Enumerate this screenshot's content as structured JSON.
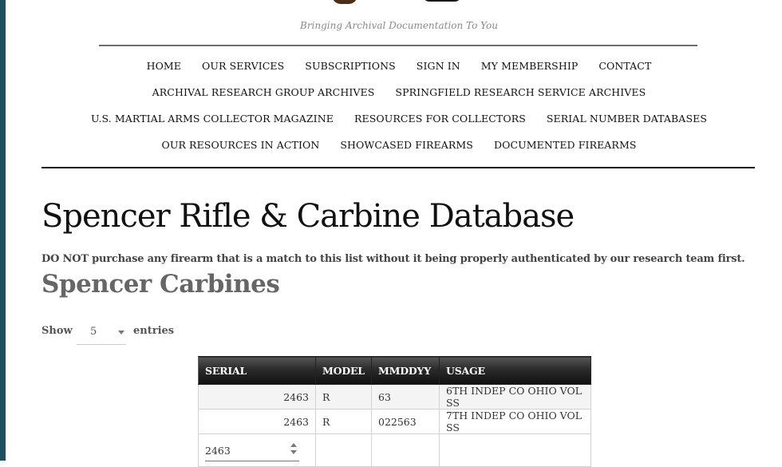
{
  "site": {
    "tagline": "Bringing Archival Documentation To You"
  },
  "nav": {
    "rows": [
      [
        "HOME",
        "OUR SERVICES",
        "SUBSCRIPTIONS",
        "SIGN IN",
        "MY MEMBERSHIP",
        "CONTACT"
      ],
      [
        "ARCHIVAL RESEARCH GROUP ARCHIVES",
        "SPRINGFIELD RESEARCH SERVICE ARCHIVES"
      ],
      [
        "U.S. MARTIAL ARMS COLLECTOR MAGAZINE",
        "RESOURCES FOR COLLECTORS",
        "SERIAL NUMBER DATABASES"
      ],
      [
        "OUR RESOURCES IN ACTION",
        "SHOWCASED FIREARMS",
        "DOCUMENTED FIREARMS"
      ]
    ]
  },
  "page": {
    "title": "Spencer Rifle & Carbine Database",
    "warning": "DO NOT purchase any firearm that is a match to this list without it being properly authenticated by our research team first.",
    "section_title": "Spencer Carbines"
  },
  "table_controls": {
    "show_label": "Show",
    "entries_value": "5",
    "entries_label": "entries"
  },
  "table": {
    "headers": [
      "SERIAL",
      "MODEL",
      "MMDDYY",
      "USAGE"
    ],
    "rows": [
      [
        "2463",
        "R",
        "63",
        "6TH INDEP CO OHIO VOL SS"
      ],
      [
        "2463",
        "R",
        "022563",
        "7TH INDEP CO OHIO VOL SS"
      ]
    ],
    "filter_value": "2463"
  },
  "colors": {
    "left_strip": "#1f4e63",
    "header_bg": "#2a2a2a",
    "rule": "#111111"
  }
}
